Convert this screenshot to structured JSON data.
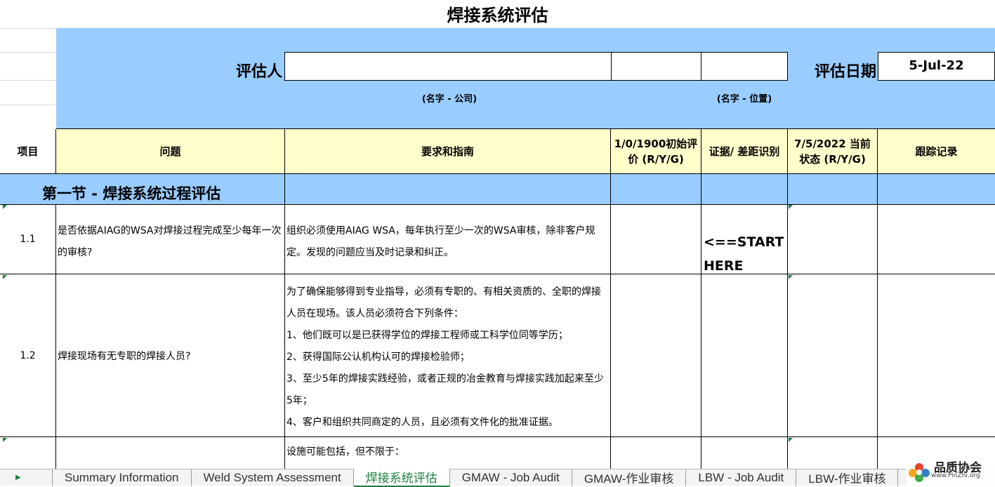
{
  "sheet": {
    "title": "焊接系统评估",
    "assessor_label": "评估人",
    "assessor_value": "",
    "assessor_hint": "(名字 - 公司)",
    "position_value": "",
    "position_hint": "(名字 - 位置)",
    "date_label": "评估日期",
    "date_value": "5-Jul-22"
  },
  "columns": {
    "item": "项目",
    "question": "问题",
    "requirement": "要求和指南",
    "initial": "1/0/1900初始评价 (R/Y/G)",
    "evidence": "证据/ 差距识别",
    "current": "7/5/2022 当前状态 (R/Y/G)",
    "tracking": "跟踪记录"
  },
  "section": {
    "title": "第一节 - 焊接系统过程评估"
  },
  "rows": [
    {
      "id": "1.1",
      "question": "是否依据AIAG的WSA对焊接过程完成至少每年一次的审核?",
      "requirement": "组织必须使用AIAG WSA，每年执行至少一次的WSA审核，除非客户规定。发现的问题应当及时记录和纠正。",
      "evidence": "<==START HERE"
    },
    {
      "id": "1.2",
      "question": "焊接现场有无专职的焊接人员?",
      "requirement_lines": [
        "为了确保能够得到专业指导，必须有专职的、有相关资质的、全职的焊接人员在现场。该人员必须符合下列条件：",
        "1、他们既可以是已获得学位的焊接工程师或工科学位同等学历；",
        "2、获得国际公认机构认可的焊接检验师；",
        "3、至少5年的焊接实践经验，或者正规的冶金教育与焊接实践加起来至少5年；",
        "4、客户和组织共同商定的人员，且必须有文件化的批准证据。"
      ]
    },
    {
      "id": "",
      "question": "",
      "requirement": "设施可能包括，但不限于："
    }
  ],
  "tabs": [
    {
      "label": "Summary Information"
    },
    {
      "label": "Weld System Assessment"
    },
    {
      "label": "焊接系统评估"
    },
    {
      "label": "GMAW - Job Audit"
    },
    {
      "label": "GMAW-作业审核"
    },
    {
      "label": "LBW - Job Audit"
    },
    {
      "label": "LBW-作业审核"
    }
  ],
  "watermark": {
    "name": "品质协会",
    "url": "www.PinZhi.org"
  },
  "colors": {
    "header_blue": "#99ccff",
    "header_yellow": "#ffffcc",
    "active_tab": "#1a7f3c"
  }
}
